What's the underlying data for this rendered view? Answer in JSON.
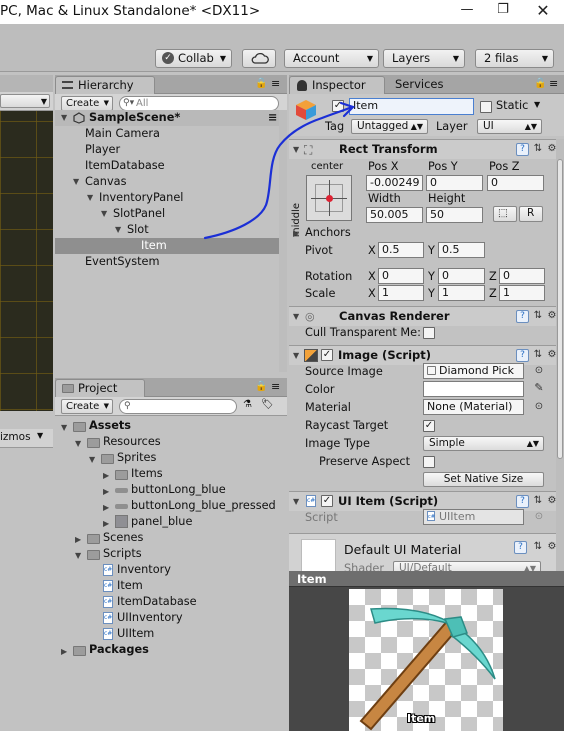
{
  "window": {
    "title": "PC, Mac & Linux Standalone* <DX11>",
    "minimize_glyph": "—",
    "restore_glyph": "❐",
    "close_glyph": "✕"
  },
  "toolbar": {
    "collab": "Collab",
    "account": "Account",
    "layers": "Layers",
    "layout": "2 filas"
  },
  "scene_panel": {
    "gizmos": "izmos"
  },
  "hierarchy": {
    "tab": "Hierarchy",
    "create": "Create",
    "search_placeholder": "All",
    "scene": "SampleScene*",
    "items": [
      "Main Camera",
      "Player",
      "ItemDatabase",
      "Canvas",
      "InventoryPanel",
      "SlotPanel",
      "Slot",
      "Item",
      "EventSystem"
    ]
  },
  "project": {
    "tab": "Project",
    "create": "Create",
    "assets": "Assets",
    "resources": "Resources",
    "sprites": "Sprites",
    "sprite_items": [
      "Items",
      "buttonLong_blue",
      "buttonLong_blue_pressed",
      "panel_blue"
    ],
    "scenes": "Scenes",
    "scripts": "Scripts",
    "script_items": [
      "Inventory",
      "Item",
      "ItemDatabase",
      "UIInventory",
      "UIItem"
    ],
    "packages": "Packages"
  },
  "inspector": {
    "tab": "Inspector",
    "tab2": "Services",
    "object_name": "Item",
    "static_label": "Static",
    "tag_label": "Tag",
    "tag_value": "Untagged",
    "layer_label": "Layer",
    "layer_value": "UI",
    "rect": {
      "title": "Rect Transform",
      "anchor_h": "center",
      "anchor_v": "middle",
      "posx_label": "Pos X",
      "posy_label": "Pos Y",
      "posz_label": "Pos Z",
      "posx": "-0.00249",
      "posy": "0",
      "posz": "0",
      "width_label": "Width",
      "height_label": "Height",
      "width": "50.005",
      "height": "50",
      "r_btn": "R",
      "anchors": "Anchors",
      "pivot": "Pivot",
      "pivot_x": "0.5",
      "pivot_y": "0.5",
      "rotation": "Rotation",
      "rot_x": "0",
      "rot_y": "0",
      "rot_z": "0",
      "scale": "Scale",
      "scale_x": "1",
      "scale_y": "1",
      "scale_z": "1",
      "x": "X",
      "y": "Y",
      "z": "Z"
    },
    "canvas_renderer": {
      "title": "Canvas Renderer",
      "cull_label": "Cull Transparent Me:"
    },
    "image": {
      "title": "Image (Script)",
      "source_label": "Source Image",
      "source_value": "Diamond Pick",
      "color_label": "Color",
      "material_label": "Material",
      "material_value": "None (Material)",
      "raycast_label": "Raycast Target",
      "type_label": "Image Type",
      "type_value": "Simple",
      "preserve_label": "Preserve Aspect",
      "native_btn": "Set Native Size"
    },
    "uiitem": {
      "title": "UI Item (Script)",
      "script_label": "Script",
      "script_value": "UIItem"
    },
    "material_section": {
      "title": "Default UI Material",
      "shader_label": "Shader",
      "shader_value": "UI/Default"
    }
  },
  "preview": {
    "header": "Item",
    "caption": "Item"
  }
}
